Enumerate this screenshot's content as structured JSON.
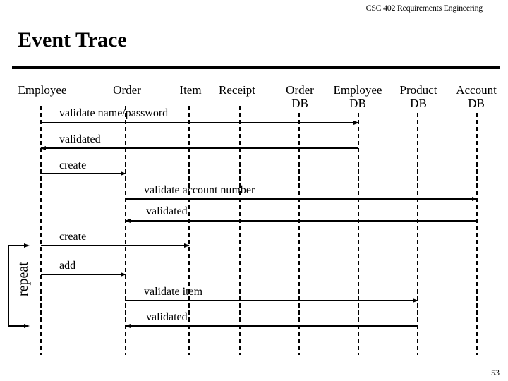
{
  "header": {
    "course": "CSC 402 Requirements Engineering",
    "title": "Event Trace"
  },
  "actors": [
    {
      "id": "employee",
      "label": "Employee"
    },
    {
      "id": "order",
      "label": "Order"
    },
    {
      "id": "item",
      "label": "Item"
    },
    {
      "id": "receipt",
      "label": "Receipt"
    },
    {
      "id": "order-db",
      "label": "Order\nDB"
    },
    {
      "id": "employee-db",
      "label": "Employee\nDB"
    },
    {
      "id": "product-db",
      "label": "Product\nDB"
    },
    {
      "id": "account-db",
      "label": "Account\nDB"
    }
  ],
  "messages": [
    {
      "label": "validate name/password",
      "from": "employee",
      "to": "employee-db"
    },
    {
      "label": "validated",
      "from": "employee-db",
      "to": "employee"
    },
    {
      "label": "create",
      "from": "employee",
      "to": "order"
    },
    {
      "label": "validate account number",
      "from": "order",
      "to": "account-db"
    },
    {
      "label": "validated",
      "from": "account-db",
      "to": "order"
    },
    {
      "label": "create",
      "from": "employee",
      "to": "item"
    },
    {
      "label": "add",
      "from": "employee",
      "to": "order"
    },
    {
      "label": "validate item",
      "from": "order",
      "to": "product-db"
    },
    {
      "label": "validated",
      "from": "product-db",
      "to": "order"
    }
  ],
  "loop": {
    "label": "repeat",
    "from_message": 5,
    "to_message": 8
  },
  "footer": {
    "page_number": "53"
  }
}
